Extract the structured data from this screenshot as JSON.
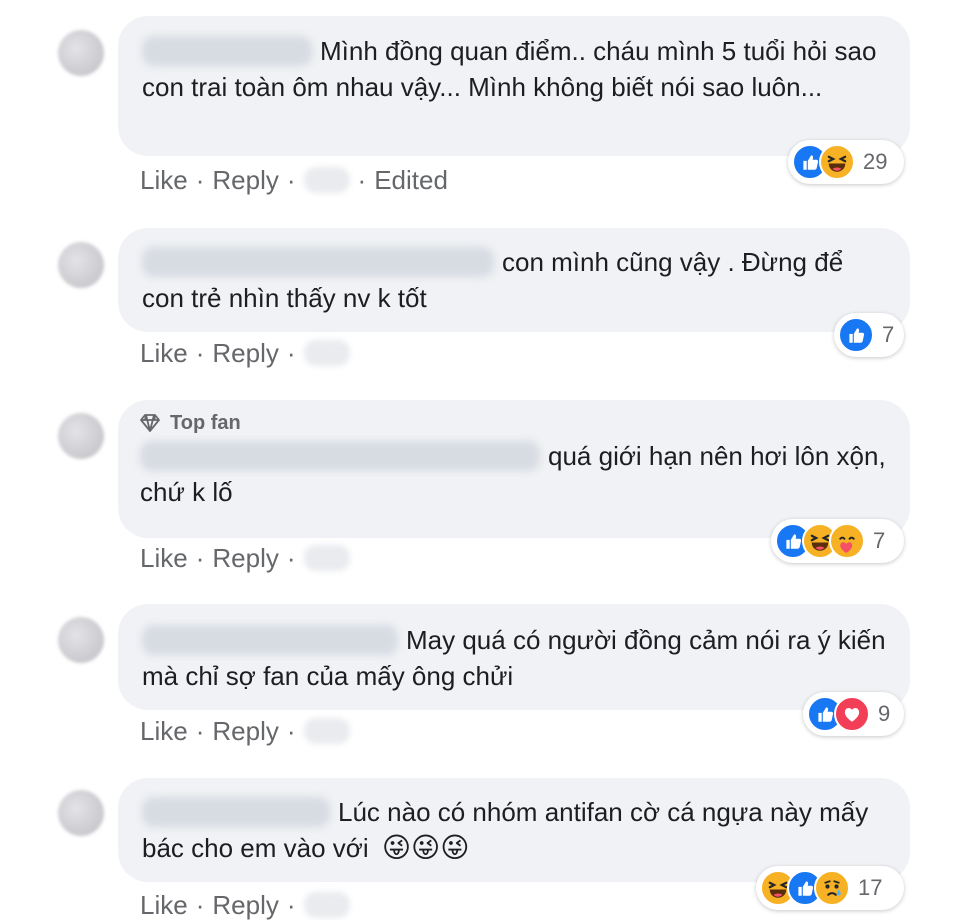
{
  "ui": {
    "like": "Like",
    "reply": "Reply",
    "sep": "·"
  },
  "comments": [
    {
      "text": "Mình đồng quan điểm.. cháu mình 5 tuổi hỏi sao con trai toàn ôm nhau vậy... Mình không biết nói sao luôn...",
      "edited": "Edited",
      "reactions": [
        "like-icon",
        "haha-icon"
      ],
      "count": "29"
    },
    {
      "text": "con mình cũng vậy . Đừng để con trẻ nhìn thấy nv k tốt",
      "reactions": [
        "like-icon"
      ],
      "count": "7"
    },
    {
      "badge": "Top fan",
      "text": "quá giới hạn nên hơi lôn xộn, chứ k lố",
      "reactions": [
        "like-icon",
        "haha-icon",
        "care-icon"
      ],
      "count": "7"
    },
    {
      "text": "May quá có người đồng cảm nói ra ý kiến mà chỉ sợ fan của mấy ông chửi",
      "reactions": [
        "like-icon",
        "love-icon"
      ],
      "count": "9"
    },
    {
      "text": "Lúc nào có nhóm antifan cờ cá ngựa này mấy bác cho em vào với",
      "emoji": "😜😜😜",
      "reactions": [
        "haha-icon",
        "like-icon",
        "sad-icon"
      ],
      "count": "17"
    }
  ]
}
